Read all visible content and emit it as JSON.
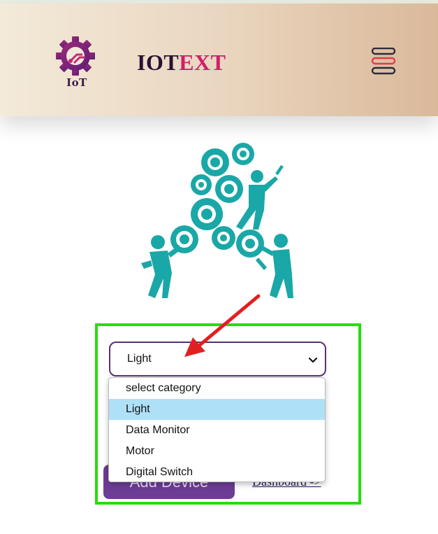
{
  "header": {
    "logo_text": "IoT",
    "brand_part1": "IOT",
    "brand_part2": "EXT",
    "menu_icon": "hamburger-menu-icon"
  },
  "hero": {
    "illustration": "people-with-gears-illustration"
  },
  "form": {
    "category_select": {
      "selected": "Light",
      "options": [
        "select category",
        "Light",
        "Data Monitor",
        "Motor",
        "Digital Switch"
      ]
    },
    "add_device_label": "Add Device",
    "dashboard_link": "Dashboard ->"
  },
  "colors": {
    "accent_purple": "#6d3c95",
    "brand_pink": "#d11f6a",
    "highlight_green": "#27dd0d",
    "annotation_red": "#e02020",
    "gear_teal": "#1aa7a7",
    "option_highlight": "#aee1f7"
  }
}
